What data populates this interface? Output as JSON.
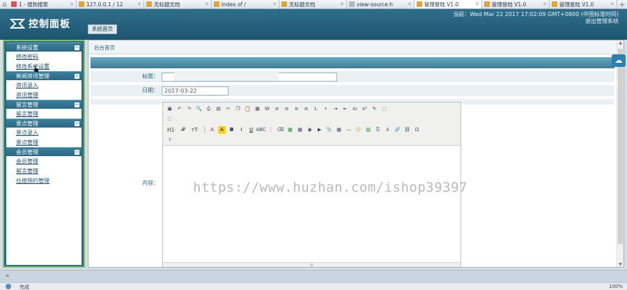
{
  "browser": {
    "tabs": [
      {
        "title": "1 - 搜狗搜索",
        "active": false,
        "color": "#d9534f"
      },
      {
        "title": "127.0.0.1 / 12",
        "active": false,
        "color": "#e0a23a"
      },
      {
        "title": "无标题文档",
        "active": false,
        "color": "#e0a23a"
      },
      {
        "title": "Index of /",
        "active": false,
        "color": "#e0a23a"
      },
      {
        "title": "无标题文档",
        "active": false,
        "color": "#e0a23a"
      },
      {
        "title": "view-source:h",
        "active": false,
        "color": "#b0b8c4"
      },
      {
        "title": "管理登陆 V1.0",
        "active": true,
        "color": "#e0a23a"
      },
      {
        "title": "管理登陆 V1.0",
        "active": false,
        "color": "#e0a23a"
      },
      {
        "title": "管理登陆 V1.0",
        "active": false,
        "color": "#e0a23a"
      }
    ],
    "home_icon": "home-icon",
    "new_tab_icon": "plus-icon"
  },
  "header": {
    "logo_text": "控制面板",
    "home_tab": "系统首页",
    "datetime": "当前：Wed Mar 22 2017 17:02:09 GMT+0800 (中国标准时间)",
    "logout": "退出管理系统"
  },
  "sidebar": {
    "groups": [
      {
        "title": "系统设置",
        "items": [
          "修改密码",
          "修改系统设置"
        ]
      },
      {
        "title": "新闻资讯管理",
        "items": [
          "资讯录入",
          "资讯管理"
        ]
      },
      {
        "title": "留言管理",
        "items": [
          "留言管理"
        ]
      },
      {
        "title": "景点管理",
        "items": [
          "景点录入",
          "景点管理"
        ]
      },
      {
        "title": "会员管理",
        "items": [
          "会员管理",
          "留言管理",
          "住宿预约管理"
        ]
      }
    ],
    "toggle_glyph": "−"
  },
  "main": {
    "breadcrumb": "后台首页",
    "form": {
      "title_label": "标题：",
      "title_value": "",
      "date_label": "日期：",
      "date_value": "2017-03-22",
      "content_label": "内容："
    },
    "editor": {
      "row1": [
        "source",
        "undo",
        "redo",
        "preview",
        "print",
        "template",
        "cut",
        "copy",
        "paste",
        "paste-text",
        "paste-word",
        "justify-left",
        "justify-center",
        "justify-right",
        "justify-full",
        "ordered-list",
        "unordered-list",
        "indent",
        "outdent",
        "subscript",
        "superscript",
        "clear-format",
        "select-all",
        "fullscreen"
      ],
      "row2_text": [
        "H1·",
        "𝓕·",
        "тT·"
      ],
      "row2_icons": [
        "font-color",
        "highlight",
        "bold",
        "italic",
        "underline",
        "strikethrough",
        "line-height",
        "remove-format",
        "image",
        "multi-image",
        "flash",
        "media",
        "insert-file",
        "table",
        "hr",
        "emoticon",
        "baidu-map",
        "page-break",
        "anchor",
        "link",
        "unlink",
        "special-char",
        "about"
      ]
    }
  },
  "watermark": "https://www.huzhan.com/ishop39397",
  "status": {
    "text": "完成",
    "zoom": "100%"
  },
  "colors": {
    "header": "#1d5570",
    "sidebar_border": "#7fc26e",
    "accent": "#2c6883"
  }
}
